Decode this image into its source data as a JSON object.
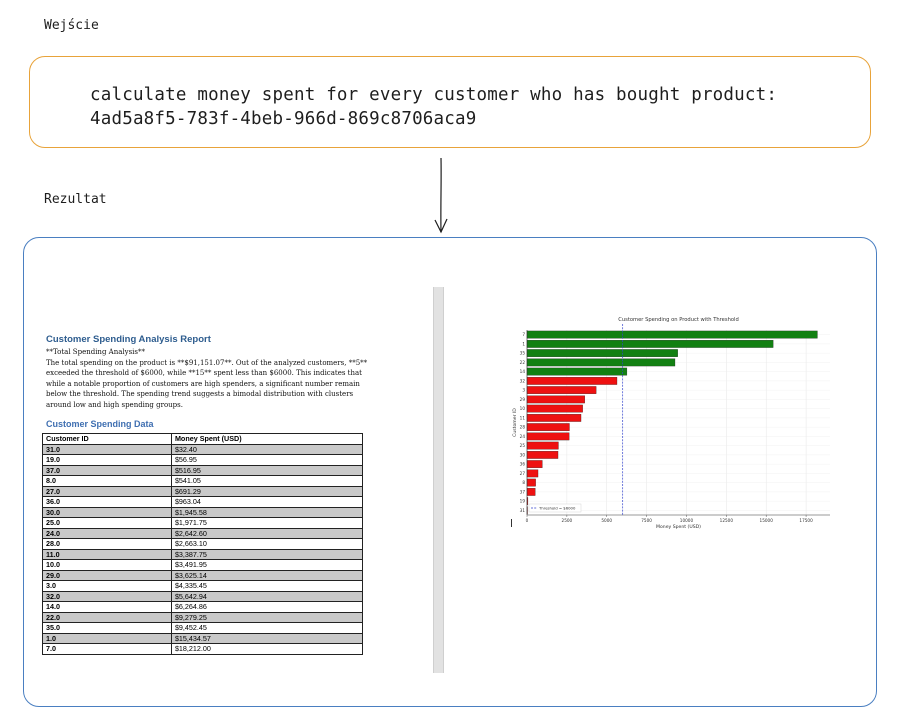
{
  "labels": {
    "input": "Wejście",
    "output": "Rezultat"
  },
  "prompt": {
    "line1": "calculate money spent for every customer who has bought product:",
    "line2": "4ad5a8f5-783f-4beb-966d-869c8706aca9"
  },
  "report": {
    "title": "Customer Spending Analysis Report",
    "summary_heading": "**Total Spending Analysis**",
    "lines": [
      "The total spending on the product is **$91,151.07**. Out of the analyzed customers, **5**",
      "exceeded the threshold of $6000, while **15** spent less than $6000. This indicates that",
      "while a notable proportion of customers are high spenders, a significant number remain",
      "below the threshold. The spending trend suggests a bimodal distribution with clusters",
      "around low and high spending groups."
    ],
    "section_title": "Customer Spending Data",
    "table": {
      "headers": [
        "Customer ID",
        "Money Spent (USD)"
      ],
      "rows": [
        [
          "31.0",
          "$32.40"
        ],
        [
          "19.0",
          "$56.95"
        ],
        [
          "37.0",
          "$516.95"
        ],
        [
          "8.0",
          "$541.05"
        ],
        [
          "27.0",
          "$691.29"
        ],
        [
          "36.0",
          "$963.04"
        ],
        [
          "30.0",
          "$1,945.58"
        ],
        [
          "25.0",
          "$1,971.75"
        ],
        [
          "24.0",
          "$2,642.60"
        ],
        [
          "28.0",
          "$2,663.10"
        ],
        [
          "11.0",
          "$3,387.75"
        ],
        [
          "10.0",
          "$3,491.95"
        ],
        [
          "29.0",
          "$3,625.14"
        ],
        [
          "3.0",
          "$4,335.45"
        ],
        [
          "32.0",
          "$5,642.94"
        ],
        [
          "14.0",
          "$6,264.86"
        ],
        [
          "22.0",
          "$9,279.25"
        ],
        [
          "35.0",
          "$9,452.45"
        ],
        [
          "1.0",
          "$15,434.57"
        ],
        [
          "7.0",
          "$18,212.00"
        ]
      ]
    }
  },
  "colors": {
    "above": "#128012",
    "below": "#ee1111",
    "threshold": "#3344cc",
    "prompt_border": "#e8a33a",
    "result_border": "#4a7fc1"
  },
  "chart_data": {
    "type": "bar",
    "orientation": "horizontal",
    "title": "Customer Spending on Product with Threshold",
    "xlabel": "Money Spent (USD)",
    "ylabel": "Customer ID",
    "categories": [
      "7",
      "1",
      "35",
      "22",
      "14",
      "32",
      "3",
      "29",
      "10",
      "11",
      "28",
      "24",
      "25",
      "30",
      "36",
      "27",
      "8",
      "37",
      "19",
      "31"
    ],
    "values": [
      18212.0,
      15434.57,
      9452.45,
      9279.25,
      6264.86,
      5642.94,
      4335.45,
      3625.14,
      3491.95,
      3387.75,
      2663.1,
      2642.6,
      1971.75,
      1945.58,
      963.04,
      691.29,
      541.05,
      516.95,
      56.95,
      32.4
    ],
    "threshold": 6000,
    "threshold_label": "Threshold = $6000",
    "xticks": [
      0,
      2500,
      5000,
      7500,
      10000,
      12500,
      15000,
      17500
    ],
    "xlim": [
      0,
      19000
    ],
    "grid": true,
    "legend": "bottom-left"
  }
}
